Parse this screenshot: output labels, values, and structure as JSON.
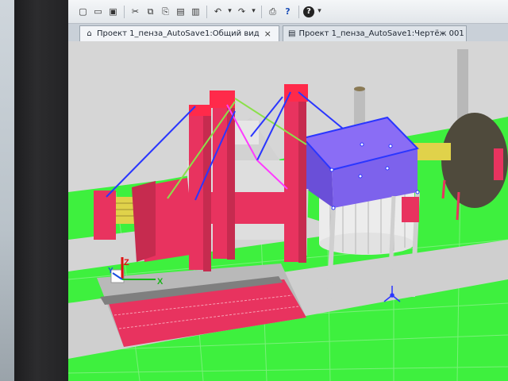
{
  "toolbar": {
    "buttons": [
      {
        "name": "new-icon",
        "glyph": "▢"
      },
      {
        "name": "open-icon",
        "glyph": "▭"
      },
      {
        "name": "save-icon",
        "glyph": "▣"
      },
      {
        "name": "cut-icon",
        "glyph": "✂"
      },
      {
        "name": "copy-icon",
        "glyph": "⧉"
      },
      {
        "name": "paste-special-icon",
        "glyph": "⎘"
      },
      {
        "name": "clipboard-icon",
        "glyph": "▤"
      },
      {
        "name": "paste-icon",
        "glyph": "▥"
      },
      {
        "name": "undo-icon",
        "glyph": "↶"
      },
      {
        "name": "undo-dropdown-icon",
        "glyph": "▾"
      },
      {
        "name": "redo-icon",
        "glyph": "↷"
      },
      {
        "name": "redo-dropdown-icon",
        "glyph": "▾"
      },
      {
        "name": "print-icon",
        "glyph": "⎙"
      },
      {
        "name": "context-help-icon",
        "glyph": "?"
      },
      {
        "name": "help-icon",
        "glyph": "?"
      },
      {
        "name": "overflow-icon",
        "glyph": "▾"
      }
    ]
  },
  "tabs": [
    {
      "label": "Проект 1_пенза_AutoSave1:Общий вид",
      "close": "×",
      "active": true
    },
    {
      "label": "Проект 1_пенза_AutoSave1:Чертёж 001",
      "active": false
    }
  ],
  "axes": {
    "x": "X",
    "y": "Y",
    "z": "Z"
  },
  "colors": {
    "ground": "#3ef03e",
    "structure": "#e8335f",
    "selection": "#7a5cf0",
    "link-blue": "#2a36ff",
    "link-green": "#8be04a",
    "link-magenta": "#ff3cff"
  }
}
